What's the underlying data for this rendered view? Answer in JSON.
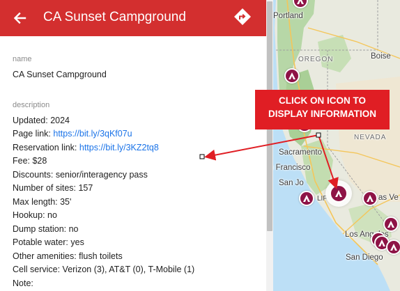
{
  "header": {
    "title": "CA Sunset Campground",
    "bg_color": "#d32f2f"
  },
  "fields": {
    "name_label": "name",
    "name_value": "CA Sunset Campground",
    "description_label": "description",
    "updated": "Updated: 2024",
    "page_link_prefix": "Page link: ",
    "page_link_url": "https://bit.ly/3qKf07u",
    "reservation_link_prefix": "Reservation link: ",
    "reservation_link_url": "https://bit.ly/3KZ2tq8",
    "fee": "Fee: $28",
    "discounts": "Discounts: senior/interagency pass",
    "sites": "Number of sites: 157",
    "max_length": "Max length: 35'",
    "hookup": "Hookup: no",
    "dump_station": "Dump station: no",
    "potable_water": "Potable water: yes",
    "amenities": "Other amenities: flush toilets",
    "cell_service": "Cell service: Verizon (3), AT&T (0), T-Mobile (1)",
    "note": "Note:"
  },
  "map": {
    "places": {
      "portland": "Portland",
      "oregon": "OREGON",
      "boise": "Boise",
      "nevada": "NEVADA",
      "sacramento": "Sacramento",
      "san_francisco": "n Francisco",
      "san_jose": "San Jo",
      "las_vegas": "as Ve",
      "los_angeles": "Los Angeles",
      "san_diego": "San Diego",
      "california_fragment": "LIF"
    },
    "pin_color": "#8e1346",
    "pin_icon": "campground-tent-icon"
  },
  "callout": {
    "line1": "CLICK ON ICON TO",
    "line2": "DISPLAY INFORMATION",
    "color": "#e01e24"
  },
  "icons": {
    "back": "arrow-left-icon",
    "directions": "directions-icon"
  }
}
